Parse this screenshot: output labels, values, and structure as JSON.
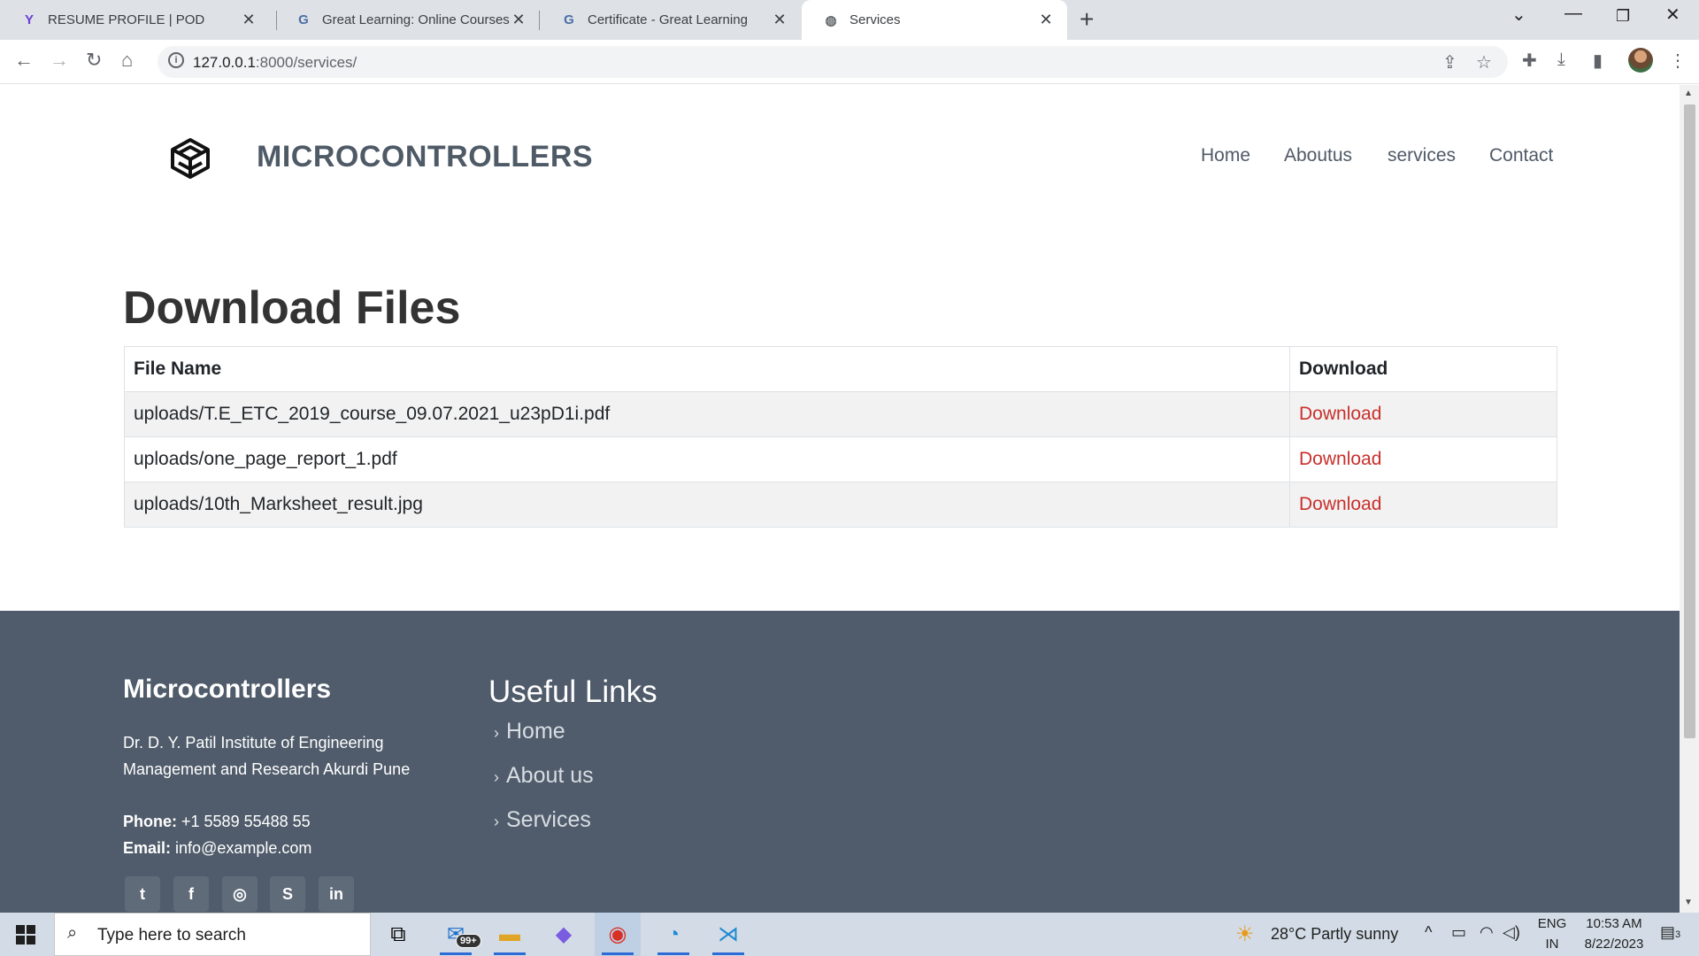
{
  "browser": {
    "tabs": [
      {
        "title": "RESUME PROFILE | POD",
        "favicon": "pod-logo-icon"
      },
      {
        "title": "Great Learning: Online Courses, P",
        "favicon": "google-g-icon"
      },
      {
        "title": "Certificate - Great Learning",
        "favicon": "google-g-icon"
      },
      {
        "title": "Services",
        "favicon": "globe-icon"
      }
    ],
    "new_tab_label": "+",
    "url_host": "127.0.0.1",
    "url_path": ":8000/services/"
  },
  "site": {
    "brand": "MICROCONTROLLERS",
    "nav": [
      "Home",
      "Aboutus",
      "services",
      "Contact"
    ]
  },
  "content": {
    "heading": "Download Files",
    "table": {
      "headers": [
        "File Name",
        "Download"
      ],
      "rows": [
        {
          "file": "uploads/T.E_ETC_2019_course_09.07.2021_u23pD1i.pdf",
          "link": "Download"
        },
        {
          "file": "uploads/one_page_report_1.pdf",
          "link": "Download"
        },
        {
          "file": "uploads/10th_Marksheet_result.jpg",
          "link": "Download"
        }
      ]
    }
  },
  "footer": {
    "brand": "Microcontrollers",
    "address_line1": "Dr. D. Y. Patil Institute of Engineering",
    "address_line2": "Management and Research Akurdi Pune",
    "phone_label": "Phone:",
    "phone": "+1 5589 55488 55",
    "email_label": "Email:",
    "email": "info@example.com",
    "social": [
      {
        "icon": "twitter-icon",
        "glyph": "t"
      },
      {
        "icon": "facebook-icon",
        "glyph": "f"
      },
      {
        "icon": "instagram-icon",
        "glyph": "◎"
      },
      {
        "icon": "skype-icon",
        "glyph": "S"
      },
      {
        "icon": "linkedin-icon",
        "glyph": "in"
      }
    ],
    "links_title": "Useful Links",
    "links": [
      "Home",
      "About us",
      "Services"
    ]
  },
  "taskbar": {
    "search_placeholder": "Type here to search",
    "mail_badge": "99+",
    "weather": "28°C  Partly sunny",
    "lang_line1": "ENG",
    "lang_line2": "IN",
    "time": "10:53 AM",
    "date": "8/22/2023",
    "notifications": "3"
  },
  "colors": {
    "brand_text": "#4f5a67",
    "footer_bg": "#505c6b",
    "download_link": "#c9302c",
    "tabstrip_bg": "#dee1e6"
  }
}
